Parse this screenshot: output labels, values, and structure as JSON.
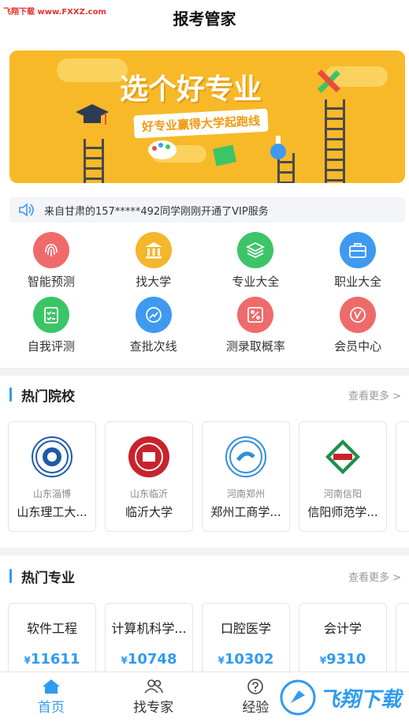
{
  "watermark_top": "飞翔下载 www.FXXZ.com",
  "header": {
    "title": "报考管家"
  },
  "banner": {
    "title": "选个好专业",
    "subtitle": "好专业赢得大学起跑线"
  },
  "notice": {
    "text": "来自甘肃的157*****492同学刚刚开通了VIP服务"
  },
  "grid": [
    {
      "label": "智能预测",
      "icon": "fingerprint-icon",
      "color": "#ef6b6b"
    },
    {
      "label": "找大学",
      "icon": "bank-icon",
      "color": "#f4b62a"
    },
    {
      "label": "专业大全",
      "icon": "layers-icon",
      "color": "#3cc567"
    },
    {
      "label": "职业大全",
      "icon": "briefcase-icon",
      "color": "#3e9af0"
    },
    {
      "label": "自我评测",
      "icon": "clipboard-icon",
      "color": "#3cc567"
    },
    {
      "label": "查批次线",
      "icon": "trend-icon",
      "color": "#3e9af0"
    },
    {
      "label": "测录取概率",
      "icon": "percent-icon",
      "color": "#ef6b6b"
    },
    {
      "label": "会员中心",
      "icon": "vip-icon",
      "color": "#ef6b6b"
    }
  ],
  "hot_schools": {
    "title": "热门院校",
    "more": "查看更多 >",
    "items": [
      {
        "loc": "山东淄博",
        "name": "山东理工大..."
      },
      {
        "loc": "山东临沂",
        "name": "临沂大学"
      },
      {
        "loc": "河南郑州",
        "name": "郑州工商学..."
      },
      {
        "loc": "河南信阳",
        "name": "信阳师范学..."
      }
    ]
  },
  "hot_majors": {
    "title": "热门专业",
    "more": "查看更多 >",
    "items": [
      {
        "name": "软件工程",
        "price": "11611"
      },
      {
        "name": "计算机科学...",
        "price": "10748"
      },
      {
        "name": "口腔医学",
        "price": "10302"
      },
      {
        "name": "会计学",
        "price": "9310"
      }
    ],
    "currency": "¥"
  },
  "tabbar": [
    {
      "label": "首页",
      "icon": "home-icon",
      "active": true
    },
    {
      "label": "找专家",
      "icon": "people-icon",
      "active": false
    },
    {
      "label": "经验",
      "icon": "question-icon",
      "active": false
    }
  ],
  "watermark_bottom": "飞翔下载",
  "colors": {
    "accent": "#2f9bf0",
    "banner": "#f7b928"
  }
}
